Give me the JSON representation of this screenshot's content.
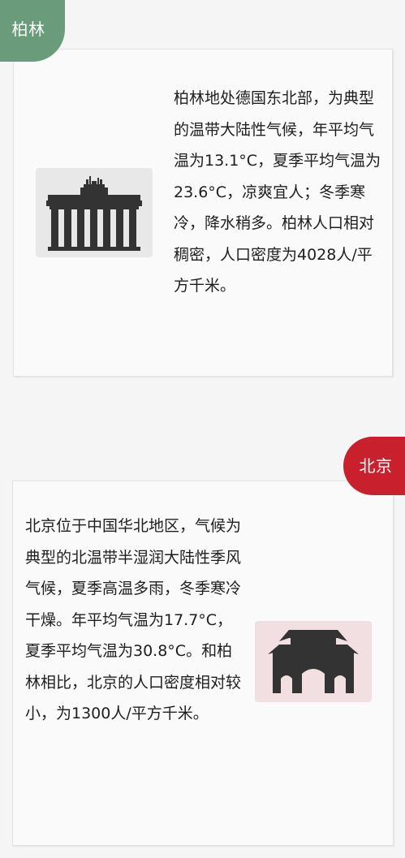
{
  "berlin": {
    "tag_label": "柏林",
    "tag_color": "#6a9c7c",
    "icon": "brandenburg-gate-icon",
    "text": "柏林地处德国东北部，为典型的温带大陆性气候，年平均气温为13.1°C，夏季平均气温为23.6°C，凉爽宜人；冬季寒冷，降水稍多。柏林人口相对稠密，人口密度为4028人/平方千米。"
  },
  "beijing": {
    "tag_label": "北京",
    "tag_color": "#c8202d",
    "icon": "chinese-gate-tower-icon",
    "text": "北京位于中国华北地区，气候为典型的北温带半湿润大陆性季风气候，夏季高温多雨，冬季寒冷干燥。年平均气温为17.7°C，夏季平均气温为30.8°C。和柏林相比，北京的人口密度相对较小，为1300人/平方千米。"
  }
}
